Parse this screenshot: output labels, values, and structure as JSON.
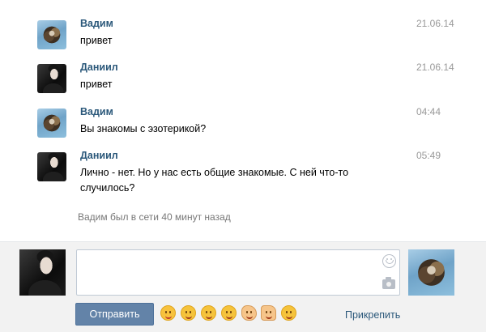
{
  "messages": [
    {
      "author": "Вадим",
      "text": "привет",
      "time": "21.06.14",
      "avatar": "crystal-avatar"
    },
    {
      "author": "Даниил",
      "text": "привет",
      "time": "21.06.14",
      "avatar": "man-avatar"
    },
    {
      "author": "Вадим",
      "text": "Вы знакомы с эзотерикой?",
      "time": "04:44",
      "avatar": "crystal-avatar"
    },
    {
      "author": "Даниил",
      "text": "Лично - нет. Но у нас есть общие знакомые. С ней что-то случилось?",
      "time": "05:49",
      "avatar": "man-avatar"
    }
  ],
  "status": "Вадим был в сети 40 минут назад",
  "compose": {
    "message_value": "",
    "send_label": "Отправить",
    "attach_label": "Прикрепить",
    "emoji": [
      "blush-emoji",
      "wink-tongue-emoji",
      "yum-emoji",
      "kiss-emoji",
      "clapping-hands-emoji",
      "thumbs-up-emoji",
      "smirk-emoji"
    ],
    "icons": [
      "smile-icon",
      "camera-icon"
    ]
  },
  "colors": {
    "link": "#2b587a",
    "time": "#999999",
    "button": "#6383a8",
    "compose_bg": "#f2f2f2"
  }
}
